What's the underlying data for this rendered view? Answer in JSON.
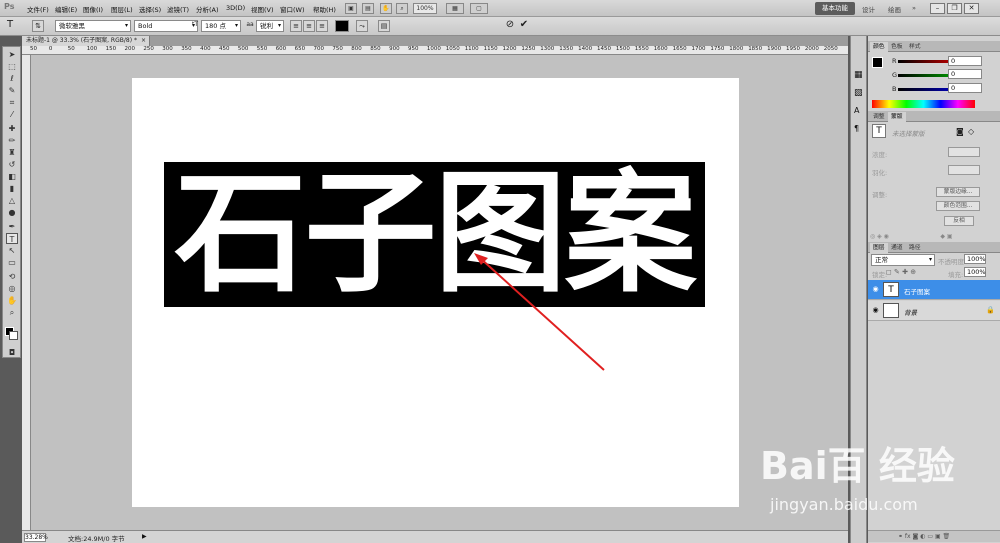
{
  "app": {
    "logo": "Ps"
  },
  "menu": [
    {
      "label": "文件(F)"
    },
    {
      "label": "编辑(E)"
    },
    {
      "label": "图像(I)"
    },
    {
      "label": "图层(L)"
    },
    {
      "label": "选择(S)"
    },
    {
      "label": "滤镜(T)"
    },
    {
      "label": "分析(A)"
    },
    {
      "label": "3D(D)"
    },
    {
      "label": "视图(V)"
    },
    {
      "label": "窗口(W)"
    },
    {
      "label": "帮助(H)"
    }
  ],
  "menubar_extra": {
    "zoom": "100%",
    "workspace": "基本功能",
    "design": "设计",
    "paint": "绘画"
  },
  "options": {
    "font_family": "微软雅黑",
    "font_style": "Bold",
    "font_size": "180 点",
    "antialias": "锐利",
    "text_color": "#000000",
    "cancel_icon": "cancel-icon",
    "commit_icon": "commit-icon"
  },
  "document": {
    "tab_label": "未标题-1 @ 33.3% (石子图案, RGB/8) *"
  },
  "ruler": {
    "top_labels": [
      "50",
      "0",
      "50",
      "100",
      "150",
      "200",
      "250",
      "300",
      "350",
      "400",
      "450",
      "500",
      "550",
      "600",
      "650",
      "700",
      "750",
      "800",
      "850",
      "900",
      "950",
      "1000",
      "1050",
      "1100",
      "1150",
      "1200",
      "1250",
      "1300",
      "1350",
      "1400",
      "1450",
      "1500",
      "1550",
      "1600",
      "1650",
      "1700",
      "1750",
      "1800",
      "1850",
      "1900",
      "1950",
      "2000",
      "2050"
    ]
  },
  "canvas": {
    "text": "石子图案",
    "accent_arrow": "#e02020"
  },
  "status": {
    "zoom": "33.28%",
    "docinfo": "文档:24.9M/0 字节"
  },
  "color_panel": {
    "tabs": [
      "颜色",
      "色板",
      "样式"
    ],
    "r_label": "R",
    "g_label": "G",
    "b_label": "B",
    "r": "0",
    "g": "0",
    "b": "0"
  },
  "adjust_panel": {
    "tabs": [
      "调整",
      "蒙版"
    ],
    "no_mask": "未选择蒙版",
    "density": "浓度:",
    "feather": "羽化:",
    "refine": "调整:",
    "mask_edge": "蒙版边缘...",
    "color_range": "颜色范围...",
    "invert": "反相"
  },
  "layers_panel": {
    "tabs": [
      "图层",
      "通道",
      "路径"
    ],
    "blend_mode": "正常",
    "opacity_label": "不透明度:",
    "opacity": "100%",
    "lock_label": "锁定:",
    "fill_label": "填充:",
    "fill": "100%",
    "layers": [
      {
        "name": "石子图案",
        "thumb": "T",
        "selected": true
      },
      {
        "name": "背景",
        "thumb": "",
        "selected": false
      }
    ]
  },
  "watermark": {
    "brand": "Bai百 经验",
    "url": "jingyan.baidu.com"
  }
}
